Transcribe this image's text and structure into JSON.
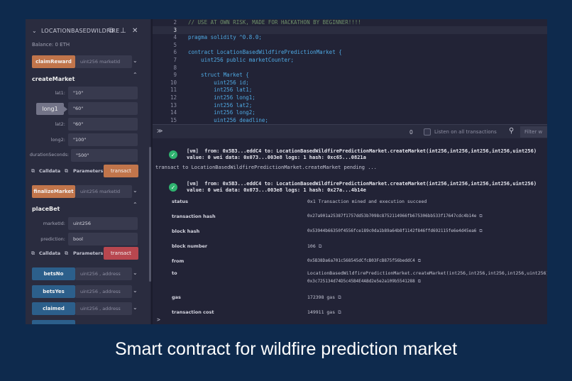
{
  "panel": {
    "title": "LOCATIONBASEDWILDFIRE",
    "balance": "Balance: 0 ETH",
    "claim_reward": {
      "label": "claimReward",
      "placeholder": "uint256 marketId"
    },
    "create_market": {
      "title": "createMarket",
      "params": [
        {
          "label": "lat1:",
          "value": "\"10\""
        },
        {
          "label": "long1:",
          "value": "\"60\""
        },
        {
          "label": "lat2:",
          "value": "\"60\""
        },
        {
          "label": "long2:",
          "value": "\"100\""
        },
        {
          "label": "durationSeconds:",
          "value": "\"500\""
        }
      ],
      "tooltip": "long1",
      "calldata": "Calldata",
      "parameters": "Parameters",
      "transact": "transact"
    },
    "finalize_market": {
      "label": "finalizeMarket",
      "placeholder": "uint256 marketId"
    },
    "place_bet": {
      "title": "placeBet",
      "params": [
        {
          "label": "marketId:",
          "placeholder": "uint256"
        },
        {
          "label": "prediction:",
          "placeholder": "bool"
        }
      ],
      "calldata": "Calldata",
      "parameters": "Parameters",
      "transact": "transact"
    },
    "getters": [
      {
        "label": "betsNo",
        "placeholder": "uint256 , address"
      },
      {
        "label": "betsYes",
        "placeholder": "uint256 , address"
      },
      {
        "label": "claimed",
        "placeholder": "uint256 , address"
      }
    ]
  },
  "editor": {
    "lines": [
      {
        "n": "2",
        "text": "// USE AT OWN RISK, MADE FOR HACKATHON BY BEGINNER!!!!"
      },
      {
        "n": "3",
        "text": ""
      },
      {
        "n": "4",
        "text": "pragma solidity ^0.8.0;"
      },
      {
        "n": "5",
        "text": ""
      },
      {
        "n": "6",
        "text": "contract LocationBasedWildfirePredictionMarket {"
      },
      {
        "n": "7",
        "text": "    uint256 public marketCounter;"
      },
      {
        "n": "8",
        "text": ""
      },
      {
        "n": "9",
        "text": "    struct Market {"
      },
      {
        "n": "10",
        "text": "        uint256 id;"
      },
      {
        "n": "11",
        "text": "        int256 lat1;"
      },
      {
        "n": "12",
        "text": "        int256 long1;"
      },
      {
        "n": "13",
        "text": "        int256 lat2;"
      },
      {
        "n": "14",
        "text": "        int256 long2;"
      },
      {
        "n": "15",
        "text": "        uint256 deadline;"
      }
    ]
  },
  "terminal_bar": {
    "count": "0",
    "listen_label": "Listen on all transactions",
    "filter_placeholder": "Filter w"
  },
  "terminal": {
    "tx1": {
      "line1_prefix": "[vm]  from: 0x5B3...eddC4 to: LocationBasedWildfirePredictionMarket.createMarket(int256,int256,int256,int256,uint256)",
      "line2": "value: 0 wei data: 0x073...003e8 logs: 1 hash: 0xc65...0821a"
    },
    "pending": "transact to LocationBasedWildfirePredictionMarket.createMarket pending ...",
    "tx2": {
      "line1_prefix": "[vm]  from: 0x5B3...eddC4 to: LocationBasedWildfirePredictionMarket.createMarket(int256,int256,int256,int256,uint256)",
      "line2": "value: 0 wei data: 0x073...003e8 logs: 1 hash: 0x27a...4b14e"
    },
    "details": [
      {
        "key": "status",
        "value": "0x1 Transaction mined and execution succeed",
        "copy": false
      },
      {
        "key": "transaction hash",
        "value": "0x27a901a25387f1757dd53b7098c8752114966fb675306bb533f17647cdc4b14e",
        "copy": true
      },
      {
        "key": "block hash",
        "value": "0x53944b66350f4556fce189c0da1b89a64b8f1142f846ffd692115fe6e4d45ea6",
        "copy": true
      },
      {
        "key": "block number",
        "value": "106",
        "copy": true
      },
      {
        "key": "from",
        "value": "0x5B38Da6a701c568545dCfcB03FcB875f56beddC4",
        "copy": true
      },
      {
        "key": "to",
        "value": "LocationBasedWildfirePredictionMarket.createMarket(int256,int256,int256,int256,uint256)",
        "value2": "0x3c725134d74D5c45B4E4ABd2e5e2a109b5541288",
        "copy": true
      },
      {
        "key": "gas",
        "value": "172398 gas",
        "copy": true
      },
      {
        "key": "transaction cost",
        "value": "149911 gas",
        "copy": true
      }
    ],
    "prompt": ">"
  },
  "caption": "Smart contract for wildfire prediction market",
  "colors": {
    "orange": "#c1754b",
    "red": "#b8474f",
    "blue": "#2c5f8b",
    "success": "#2fb36f",
    "background": "#0e2a4d"
  }
}
